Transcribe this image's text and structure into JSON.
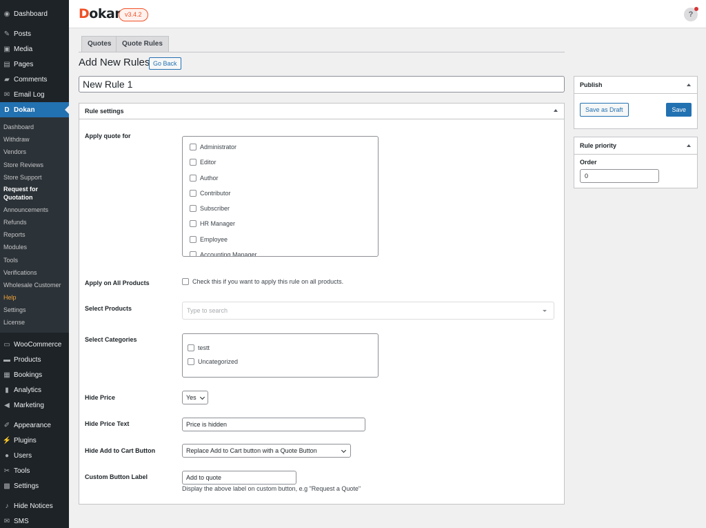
{
  "sidebar": {
    "top_items": [
      {
        "label": "Dashboard",
        "icon": "dashboard-icon"
      },
      {
        "label": "Posts",
        "icon": "pin-icon"
      },
      {
        "label": "Media",
        "icon": "media-icon"
      },
      {
        "label": "Pages",
        "icon": "pages-icon"
      },
      {
        "label": "Comments",
        "icon": "comment-icon"
      },
      {
        "label": "Email Log",
        "icon": "email-icon"
      },
      {
        "label": "Dokan",
        "icon": "dokan-icon"
      }
    ],
    "dokan_submenu": [
      "Dashboard",
      "Withdraw",
      "Vendors",
      "Store Reviews",
      "Store Support",
      "Request for",
      "Quotation",
      "Announcements",
      "Refunds",
      "Reports",
      "Modules",
      "Tools",
      "Verifications",
      "Wholesale Customer",
      "Help",
      "Settings",
      "License"
    ],
    "bottom_items": [
      {
        "label": "WooCommerce",
        "icon": "woo-icon"
      },
      {
        "label": "Products",
        "icon": "products-icon"
      },
      {
        "label": "Bookings",
        "icon": "calendar-icon"
      },
      {
        "label": "Analytics",
        "icon": "analytics-icon"
      },
      {
        "label": "Marketing",
        "icon": "megaphone-icon"
      },
      {
        "label": "Appearance",
        "icon": "brush-icon"
      },
      {
        "label": "Plugins",
        "icon": "plugin-icon"
      },
      {
        "label": "Users",
        "icon": "user-icon"
      },
      {
        "label": "Tools",
        "icon": "wrench-icon"
      },
      {
        "label": "Settings",
        "icon": "settings-icon"
      },
      {
        "label": "Hide Notices",
        "icon": "bell-icon"
      },
      {
        "label": "SMS",
        "icon": "sms-icon"
      }
    ]
  },
  "header": {
    "logo_first": "D",
    "logo_rest": "okan",
    "version": "v3.4.2",
    "help_glyph": "?"
  },
  "tabs": [
    "Quotes",
    "Quote Rules"
  ],
  "page": {
    "title": "Add New Rules",
    "go_back": "Go Back",
    "rule_title": "New Rule 1"
  },
  "rule_settings": {
    "heading": "Rule settings",
    "apply_quote_for_label": "Apply quote for",
    "roles": [
      "Administrator",
      "Editor",
      "Author",
      "Contributor",
      "Subscriber",
      "HR Manager",
      "Employee",
      "Accounting Manager"
    ],
    "apply_all_label": "Apply on All Products",
    "apply_all_text": "Check this if you want to apply this rule on all products.",
    "select_products_label": "Select Products",
    "select_products_placeholder": "Type to search",
    "select_categories_label": "Select Categories",
    "categories": [
      "testt",
      "Uncategorized"
    ],
    "hide_price_label": "Hide Price",
    "hide_price_value": "Yes",
    "hide_price_text_label": "Hide Price Text",
    "hide_price_text_value": "Price is hidden",
    "hide_cart_label": "Hide Add to Cart Button",
    "hide_cart_value": "Replace Add to Cart button with a Quote Button",
    "custom_label_label": "Custom Button Label",
    "custom_label_value": "Add to quote",
    "custom_label_desc": "Display the above label on custom button, e.g \"Request a Quote\""
  },
  "publish": {
    "heading": "Publish",
    "draft": "Save as Draft",
    "save": "Save"
  },
  "priority": {
    "heading": "Rule priority",
    "order_label": "Order",
    "order_value": "0"
  },
  "colors": {
    "accent": "#2271b1",
    "brand": "#f05025",
    "sidebar_bg": "#1d2327"
  }
}
